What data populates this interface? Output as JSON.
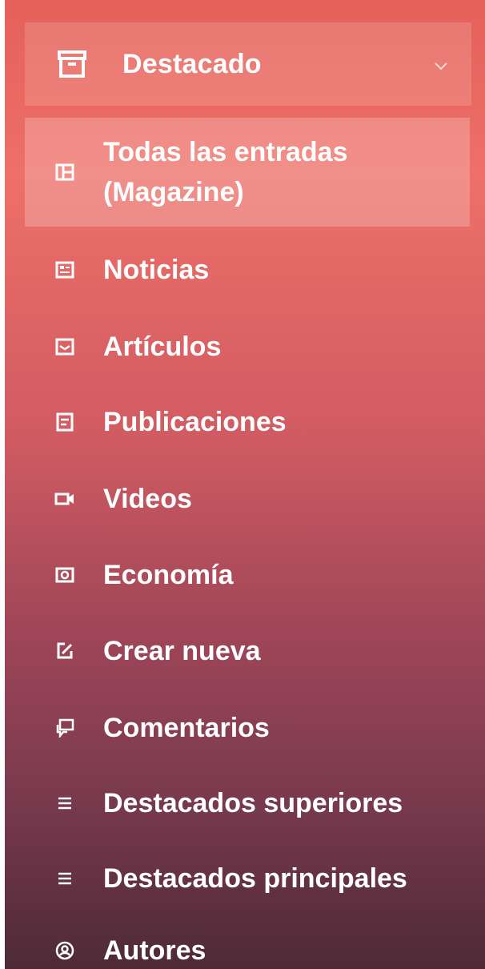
{
  "menu": {
    "header": {
      "title": "Destacado",
      "icon": "archive-box-icon",
      "chevron": "chevron-down-icon"
    },
    "items": [
      {
        "label": "Todas las entradas (Magazine)",
        "icon": "layout-icon",
        "active": true
      },
      {
        "label": "Noticias",
        "icon": "newspaper-icon"
      },
      {
        "label": "Artículos",
        "icon": "inbox-icon"
      },
      {
        "label": "Publicaciones",
        "icon": "document-lines-icon"
      },
      {
        "label": "Videos",
        "icon": "video-camera-icon"
      },
      {
        "label": "Economía",
        "icon": "money-icon"
      },
      {
        "label": "Crear nueva",
        "icon": "edit-icon"
      },
      {
        "label": "Comentarios",
        "icon": "comments-icon"
      },
      {
        "label": "Destacados superiores",
        "icon": "list-icon"
      },
      {
        "label": "Destacados principales",
        "icon": "list-icon"
      },
      {
        "label": "Autores",
        "icon": "user-circle-icon"
      }
    ]
  }
}
